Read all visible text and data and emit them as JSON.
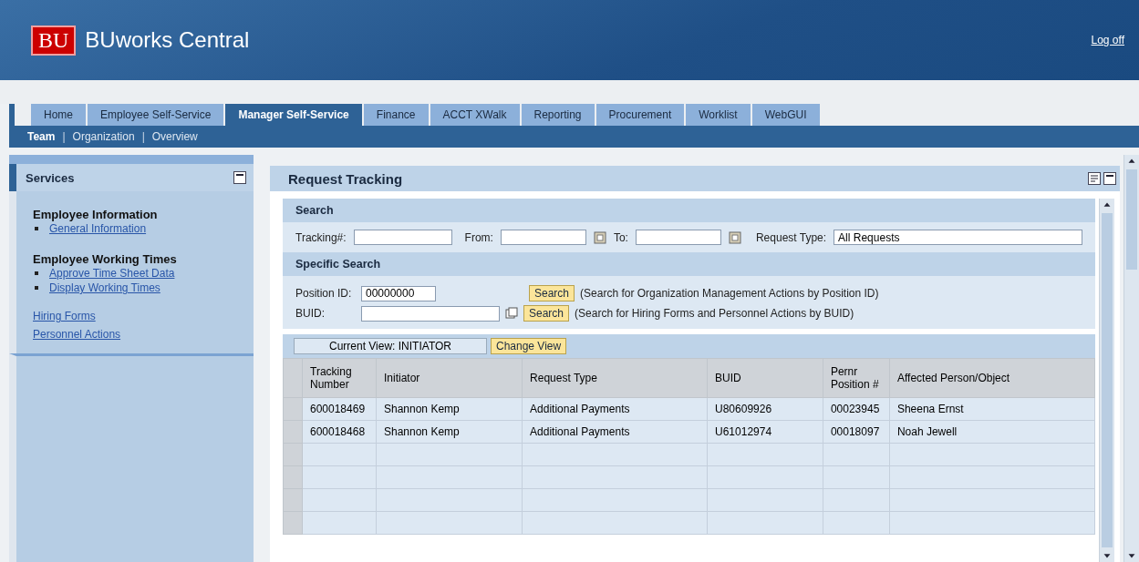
{
  "header": {
    "logo": "BU",
    "title": "BUworks Central",
    "logoff": "Log off"
  },
  "tabs": [
    {
      "label": "Home",
      "selected": false
    },
    {
      "label": "Employee Self-Service",
      "selected": false
    },
    {
      "label": "Manager Self-Service",
      "selected": true
    },
    {
      "label": "Finance",
      "selected": false
    },
    {
      "label": "ACCT XWalk",
      "selected": false
    },
    {
      "label": "Reporting",
      "selected": false
    },
    {
      "label": "Procurement",
      "selected": false
    },
    {
      "label": "Worklist",
      "selected": false
    },
    {
      "label": "WebGUI",
      "selected": false
    }
  ],
  "subtabs": {
    "separator": "|",
    "items": [
      {
        "label": "Team",
        "selected": true
      },
      {
        "label": "Organization",
        "selected": false
      },
      {
        "label": "Overview",
        "selected": false
      }
    ]
  },
  "sidebar": {
    "title": "Services",
    "groups": [
      {
        "heading": "Employee Information",
        "links": [
          "General Information"
        ]
      },
      {
        "heading": "Employee Working Times",
        "links": [
          "Approve Time Sheet Data",
          "Display Working Times"
        ]
      }
    ],
    "links": [
      "Hiring Forms",
      "Personnel Actions"
    ]
  },
  "panel": {
    "title": "Request Tracking",
    "search": {
      "title": "Search",
      "tracking_label": "Tracking#:",
      "from_label": "From:",
      "to_label": "To:",
      "type_label": "Request Type:",
      "type_value": "All Requests"
    },
    "specific": {
      "title": "Specific Search",
      "position_label": "Position ID:",
      "position_value": "00000000",
      "position_button": "Search",
      "position_note": "(Search for Organization Management Actions by Position ID)",
      "buid_label": "BUID:",
      "buid_button": "Search",
      "buid_note": "(Search for Hiring Forms and Personnel Actions by BUID)"
    },
    "view": {
      "current": "Current View: INITIATOR",
      "button": "Change View"
    },
    "table": {
      "columns": [
        "Tracking Number",
        "Initiator",
        "Request Type",
        "BUID",
        "Pernr Position #",
        "Affected Person/Object"
      ],
      "rows": [
        [
          "600018469",
          "Shannon Kemp",
          "Additional Payments",
          "U80609926",
          "00023945",
          "Sheena Ernst"
        ],
        [
          "600018468",
          "Shannon Kemp",
          "Additional Payments",
          "U61012974",
          "00018097",
          "Noah Jewell"
        ]
      ]
    }
  }
}
